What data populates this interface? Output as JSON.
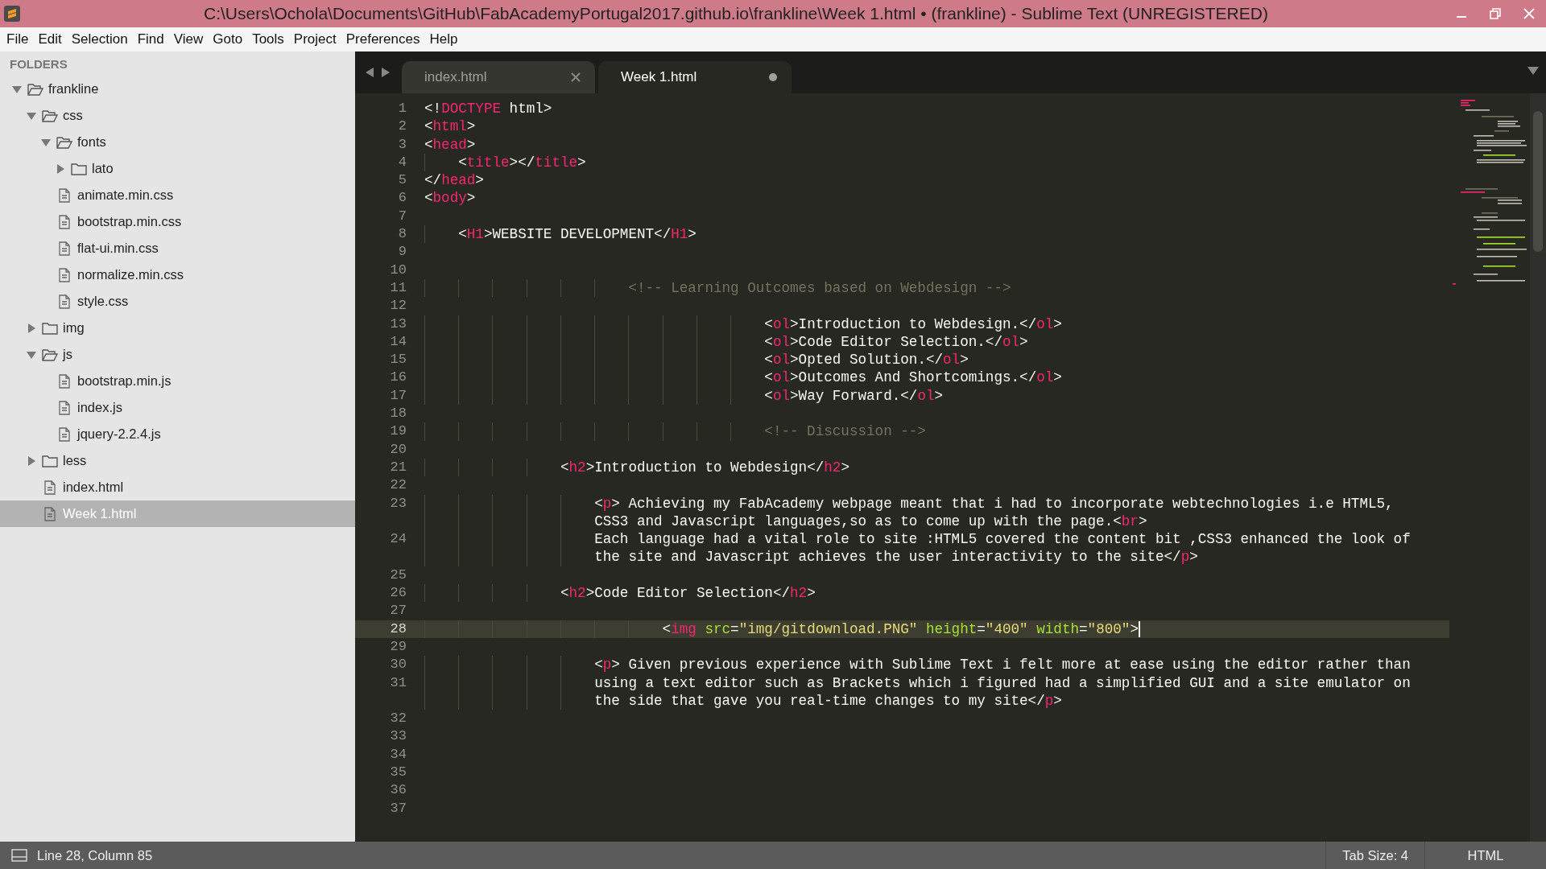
{
  "window": {
    "title": "C:\\Users\\Ochola\\Documents\\GitHub\\FabAcademyPortugal2017.github.io\\frankline\\Week 1.html • (frankline) - Sublime Text (UNREGISTERED)"
  },
  "menu": [
    "File",
    "Edit",
    "Selection",
    "Find",
    "View",
    "Goto",
    "Tools",
    "Project",
    "Preferences",
    "Help"
  ],
  "sidebar": {
    "header": "FOLDERS",
    "items": [
      {
        "label": "frankline",
        "kind": "folder",
        "expanded": true,
        "selected": false,
        "children": [
          {
            "label": "css",
            "kind": "folder",
            "expanded": true,
            "selected": false,
            "children": [
              {
                "label": "fonts",
                "kind": "folder",
                "expanded": true,
                "selected": false,
                "children": [
                  {
                    "label": "lato",
                    "kind": "folder",
                    "expanded": false,
                    "selected": false
                  }
                ]
              },
              {
                "label": "animate.min.css",
                "kind": "file",
                "selected": false
              },
              {
                "label": "bootstrap.min.css",
                "kind": "file",
                "selected": false
              },
              {
                "label": "flat-ui.min.css",
                "kind": "file",
                "selected": false
              },
              {
                "label": "normalize.min.css",
                "kind": "file",
                "selected": false
              },
              {
                "label": "style.css",
                "kind": "file",
                "selected": false
              }
            ]
          },
          {
            "label": "img",
            "kind": "folder",
            "expanded": false,
            "selected": false
          },
          {
            "label": "js",
            "kind": "folder",
            "expanded": true,
            "selected": false,
            "children": [
              {
                "label": "bootstrap.min.js",
                "kind": "file",
                "selected": false
              },
              {
                "label": "index.js",
                "kind": "file",
                "selected": false
              },
              {
                "label": "jquery-2.2.4.js",
                "kind": "file",
                "selected": false
              }
            ]
          },
          {
            "label": "less",
            "kind": "folder",
            "expanded": false,
            "selected": false
          },
          {
            "label": "index.html",
            "kind": "file",
            "selected": false
          },
          {
            "label": "Week 1.html",
            "kind": "file",
            "selected": true
          }
        ]
      }
    ]
  },
  "tabs": [
    {
      "label": "index.html",
      "selected": false,
      "modified": false
    },
    {
      "label": "Week 1.html",
      "selected": true,
      "modified": true
    }
  ],
  "editor": {
    "lines": [
      {
        "number": "1",
        "current": false,
        "wraps": [
          {
            "tokens": [
              {
                "kind": "text",
                "t": "<!"
              },
              {
                "kind": "tag",
                "t": "DOCTYPE"
              },
              {
                "kind": "text",
                "t": " html>"
              }
            ]
          }
        ]
      },
      {
        "number": "2",
        "current": false,
        "wraps": [
          {
            "tokens": [
              {
                "kind": "text",
                "t": "<"
              },
              {
                "kind": "tag",
                "t": "html"
              },
              {
                "kind": "text",
                "t": ">"
              }
            ]
          }
        ]
      },
      {
        "number": "3",
        "current": false,
        "wraps": [
          {
            "tokens": [
              {
                "kind": "text",
                "t": "<"
              },
              {
                "kind": "tag",
                "t": "head"
              },
              {
                "kind": "text",
                "t": ">"
              }
            ]
          }
        ]
      },
      {
        "number": "4",
        "current": false,
        "wraps": [
          {
            "tokens": [
              {
                "kind": "text",
                "t": "    <"
              },
              {
                "kind": "tag",
                "t": "title"
              },
              {
                "kind": "text",
                "t": "></"
              },
              {
                "kind": "tag",
                "t": "title"
              },
              {
                "kind": "text",
                "t": ">"
              }
            ]
          }
        ]
      },
      {
        "number": "5",
        "current": false,
        "wraps": [
          {
            "tokens": [
              {
                "kind": "text",
                "t": "</"
              },
              {
                "kind": "tag",
                "t": "head"
              },
              {
                "kind": "text",
                "t": ">"
              }
            ]
          }
        ]
      },
      {
        "number": "6",
        "current": false,
        "wraps": [
          {
            "tokens": [
              {
                "kind": "text",
                "t": "<"
              },
              {
                "kind": "tag",
                "t": "body"
              },
              {
                "kind": "text",
                "t": ">"
              }
            ]
          }
        ]
      },
      {
        "number": "7",
        "current": false
      },
      {
        "number": "8",
        "current": false,
        "wraps": [
          {
            "tokens": [
              {
                "kind": "text",
                "t": "    <"
              },
              {
                "kind": "tag",
                "t": "H1"
              },
              {
                "kind": "text",
                "t": ">WEBSITE DEVELOPMENT</"
              },
              {
                "kind": "tag",
                "t": "H1"
              },
              {
                "kind": "text",
                "t": ">"
              }
            ]
          }
        ]
      },
      {
        "number": "9",
        "current": false
      },
      {
        "number": "10",
        "current": false
      },
      {
        "number": "11",
        "current": false,
        "wraps": [
          {
            "tokens": [
              {
                "kind": "comment",
                "t": "                        <!-- Learning Outcomes based on Webdesign -->"
              }
            ]
          }
        ]
      },
      {
        "number": "12",
        "current": false
      },
      {
        "number": "13",
        "current": false,
        "wraps": [
          {
            "tokens": [
              {
                "kind": "text",
                "t": "                                        <"
              },
              {
                "kind": "tag",
                "t": "ol"
              },
              {
                "kind": "text",
                "t": ">Introduction to Webdesign.</"
              },
              {
                "kind": "tag",
                "t": "ol"
              },
              {
                "kind": "text",
                "t": ">"
              }
            ]
          }
        ]
      },
      {
        "number": "14",
        "current": false,
        "wraps": [
          {
            "tokens": [
              {
                "kind": "text",
                "t": "                                        <"
              },
              {
                "kind": "tag",
                "t": "ol"
              },
              {
                "kind": "text",
                "t": ">Code Editor Selection.</"
              },
              {
                "kind": "tag",
                "t": "ol"
              },
              {
                "kind": "text",
                "t": ">"
              }
            ]
          }
        ]
      },
      {
        "number": "15",
        "current": false,
        "wraps": [
          {
            "tokens": [
              {
                "kind": "text",
                "t": "                                        <"
              },
              {
                "kind": "tag",
                "t": "ol"
              },
              {
                "kind": "text",
                "t": ">Opted Solution.</"
              },
              {
                "kind": "tag",
                "t": "ol"
              },
              {
                "kind": "text",
                "t": ">"
              }
            ]
          }
        ]
      },
      {
        "number": "16",
        "current": false,
        "wraps": [
          {
            "tokens": [
              {
                "kind": "text",
                "t": "                                        <"
              },
              {
                "kind": "tag",
                "t": "ol"
              },
              {
                "kind": "text",
                "t": ">Outcomes And Shortcomings.</"
              },
              {
                "kind": "tag",
                "t": "ol"
              },
              {
                "kind": "text",
                "t": ">"
              }
            ]
          }
        ]
      },
      {
        "number": "17",
        "current": false,
        "wraps": [
          {
            "tokens": [
              {
                "kind": "text",
                "t": "                                        <"
              },
              {
                "kind": "tag",
                "t": "ol"
              },
              {
                "kind": "text",
                "t": ">Way Forward.</"
              },
              {
                "kind": "tag",
                "t": "ol"
              },
              {
                "kind": "text",
                "t": ">"
              }
            ]
          }
        ]
      },
      {
        "number": "18",
        "current": false
      },
      {
        "number": "19",
        "current": false,
        "wraps": [
          {
            "tokens": [
              {
                "kind": "comment",
                "t": "                                        <!-- Discussion -->"
              }
            ]
          }
        ]
      },
      {
        "number": "20",
        "current": false
      },
      {
        "number": "21",
        "current": false,
        "wraps": [
          {
            "tokens": [
              {
                "kind": "text",
                "t": "                <"
              },
              {
                "kind": "tag",
                "t": "h2"
              },
              {
                "kind": "text",
                "t": ">Introduction to Webdesign</"
              },
              {
                "kind": "tag",
                "t": "h2"
              },
              {
                "kind": "text",
                "t": ">"
              }
            ]
          }
        ]
      },
      {
        "number": "22",
        "current": false
      },
      {
        "number": "23",
        "current": false,
        "wraps": [
          {
            "tokens": [
              {
                "kind": "text",
                "t": "                    <"
              },
              {
                "kind": "tag",
                "t": "p"
              },
              {
                "kind": "text",
                "t": "> Achieving my FabAcademy webpage meant that i had to incorporate webtechnologies i.e HTML5,"
              }
            ]
          },
          {
            "tokens": [
              {
                "kind": "text",
                "t": "                    CSS3 and Javascript languages,so as to come up with the page.<"
              },
              {
                "kind": "tag",
                "t": "br"
              },
              {
                "kind": "text",
                "t": ">"
              }
            ]
          }
        ]
      },
      {
        "number": "24",
        "current": false,
        "wraps": [
          {
            "tokens": [
              {
                "kind": "text",
                "t": "                    Each language had a vital role to site :HTML5 covered the content bit ,CSS3 enhanced the look of"
              }
            ]
          },
          {
            "tokens": [
              {
                "kind": "text",
                "t": "                    the site and Javascript achieves the user interactivity to the site</"
              },
              {
                "kind": "tag",
                "t": "p"
              },
              {
                "kind": "text",
                "t": ">"
              }
            ]
          }
        ]
      },
      {
        "number": "25",
        "current": false
      },
      {
        "number": "26",
        "current": false,
        "wraps": [
          {
            "tokens": [
              {
                "kind": "text",
                "t": "                <"
              },
              {
                "kind": "tag",
                "t": "h2"
              },
              {
                "kind": "text",
                "t": ">Code Editor Selection</"
              },
              {
                "kind": "tag",
                "t": "h2"
              },
              {
                "kind": "text",
                "t": ">"
              }
            ]
          }
        ]
      },
      {
        "number": "27",
        "current": false
      },
      {
        "number": "28",
        "current": true,
        "wraps": [
          {
            "tokens": [
              {
                "kind": "text",
                "t": "                            <"
              },
              {
                "kind": "tag",
                "t": "img"
              },
              {
                "kind": "attr",
                "t": " src"
              },
              {
                "kind": "text",
                "t": "="
              },
              {
                "kind": "str",
                "t": "\"img/gitdownload.PNG\""
              },
              {
                "kind": "attr",
                "t": " height"
              },
              {
                "kind": "text",
                "t": "="
              },
              {
                "kind": "str",
                "t": "\"400\""
              },
              {
                "kind": "attr",
                "t": " width"
              },
              {
                "kind": "text",
                "t": "="
              },
              {
                "kind": "str",
                "t": "\"800\""
              },
              {
                "kind": "text",
                "t": ">"
              }
            ]
          }
        ]
      },
      {
        "number": "29",
        "current": false
      },
      {
        "number": "30",
        "current": false,
        "wraps": [
          {
            "tokens": [
              {
                "kind": "text",
                "t": "                    <"
              },
              {
                "kind": "tag",
                "t": "p"
              },
              {
                "kind": "text",
                "t": "> Given previous experience with Sublime Text i felt more at ease using the editor rather than"
              }
            ]
          }
        ]
      },
      {
        "number": "31",
        "current": false,
        "wraps": [
          {
            "tokens": [
              {
                "kind": "text",
                "t": "                    using a text editor such as Brackets which i figured had a simplified GUI and a site emulator on"
              }
            ]
          },
          {
            "tokens": [
              {
                "kind": "text",
                "t": "                    the side that gave you real-time changes to my site</"
              },
              {
                "kind": "tag",
                "t": "p"
              },
              {
                "kind": "text",
                "t": ">"
              }
            ]
          }
        ]
      },
      {
        "number": "32",
        "current": false
      },
      {
        "number": "33",
        "current": false
      },
      {
        "number": "34",
        "current": false
      },
      {
        "number": "35",
        "current": false
      },
      {
        "number": "36",
        "current": false
      },
      {
        "number": "37",
        "current": false
      }
    ]
  },
  "status_bar": {
    "position": "Line 28, Column 85",
    "tab_size": "Tab Size: 4",
    "syntax": "HTML"
  }
}
